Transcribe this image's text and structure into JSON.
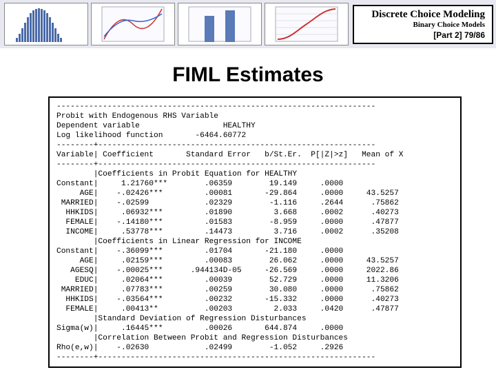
{
  "header": {
    "title_main": "Discrete Choice Modeling",
    "title_sub": "Binary Choice Models",
    "part": "[Part 2]  79/86"
  },
  "page": {
    "heading": "FIML Estimates"
  },
  "output": {
    "divider": "---------------------------------------------------------------------",
    "model_line": "Probit with Endogenous RHS Variable",
    "dep_line": "Dependent variable                  HEALTHY",
    "ll_line": "Log likelihood function       -6464.60772",
    "sep": "--------+------------------------------------------------------------",
    "col_header": "Variable| Coefficient       Standard Error   b/St.Er.  P[|Z|>z]   Mean of X",
    "sec1": "        |Coefficients in Probit Equation for HEALTHY",
    "rows1": [
      "Constant|     1.21760***        .06359        19.149     .0000",
      "     AGE|    -.02426***         .00081       -29.864     .0000     43.5257",
      " MARRIED|    -.02599            .02329        -1.116     .2644      .75862",
      "  HHKIDS|     .06932***         .01890         3.668     .0002      .40273",
      "  FEMALE|    -.14180***         .01583        -8.959     .0000      .47877",
      "  INCOME|     .53778***         .14473         3.716     .0002      .35208"
    ],
    "sec2": "        |Coefficients in Linear Regression for INCOME",
    "rows2": [
      "Constant|    -.36099***         .01704       -21.180     .0000",
      "     AGE|     .02159***         .00083        26.062     .0000     43.5257",
      "   AGESQ|    -.00025***      .944134D-05     -26.569     .0000     2022.86",
      "    EDUC|     .02064***         .00039        52.729     .0000     11.3206",
      " MARRIED|     .07783***         .00259        30.080     .0000      .75862",
      "  HHKIDS|    -.03564***         .00232       -15.332     .0000      .40273",
      "  FEMALE|     .00413**          .00203         2.033     .0420      .47877"
    ],
    "sec3": "        |Standard Deviation of Regression Disturbances",
    "row3": "Sigma(w)|     .16445***         .00026       644.874     .0000",
    "sec4": "        |Correlation Between Probit and Regression Disturbances",
    "row4": "Rho(e,w)|    -.02630            .02499        -1.052     .2926"
  }
}
